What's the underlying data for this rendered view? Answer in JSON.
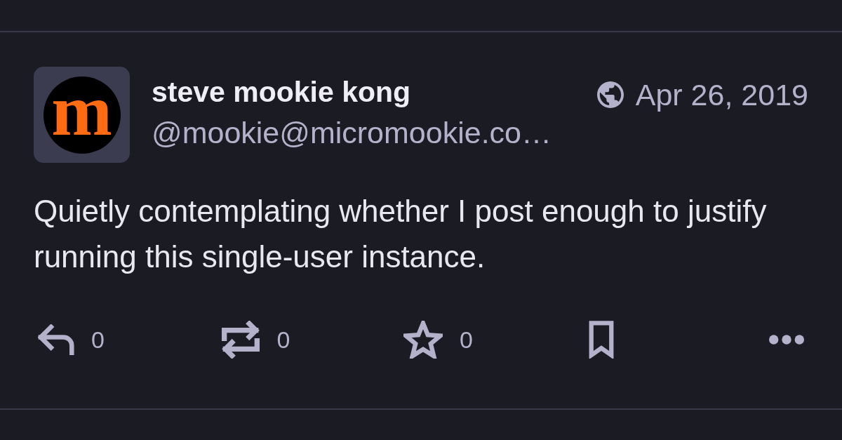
{
  "post": {
    "avatar": {
      "letter": "m"
    },
    "author": {
      "name": "steve mookie kong",
      "handle": "@mookie@micromookie.co…"
    },
    "date": "Apr 26, 2019",
    "text": "Quietly contemplating whether I post enough to justify running this single-user instance."
  },
  "actions": [
    {
      "kind": "reply",
      "count": "0"
    },
    {
      "kind": "boost",
      "count": "0"
    },
    {
      "kind": "favourite",
      "count": "0"
    },
    {
      "kind": "bookmark"
    },
    {
      "kind": "more"
    }
  ]
}
